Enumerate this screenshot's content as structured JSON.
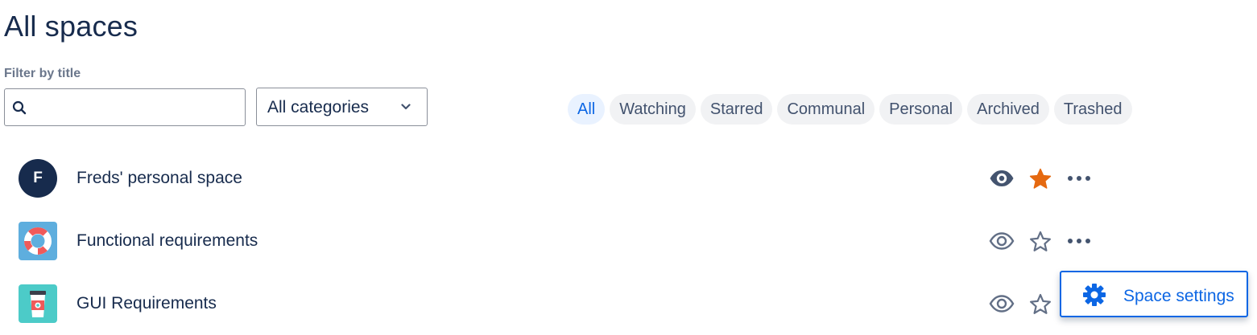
{
  "page": {
    "title": "All spaces"
  },
  "filter": {
    "label": "Filter by title",
    "search_value": "",
    "search_placeholder": ""
  },
  "category_select": {
    "selected": "All categories"
  },
  "tabs": [
    {
      "label": "All",
      "active": true
    },
    {
      "label": "Watching",
      "active": false
    },
    {
      "label": "Starred",
      "active": false
    },
    {
      "label": "Communal",
      "active": false
    },
    {
      "label": "Personal",
      "active": false
    },
    {
      "label": "Archived",
      "active": false
    },
    {
      "label": "Trashed",
      "active": false
    }
  ],
  "spaces": [
    {
      "name": "Freds' personal space",
      "avatar": "F",
      "avatar_icon": "letter-avatar",
      "watching": true,
      "starred": true
    },
    {
      "name": "Functional requirements",
      "avatar_icon": "lifebuoy-icon",
      "watching": false,
      "starred": false
    },
    {
      "name": "GUI Requirements",
      "avatar_icon": "coffee-cup-icon",
      "watching": false,
      "starred": false
    }
  ],
  "context_menu": {
    "item_label": "Space settings",
    "item_icon": "gear-icon"
  },
  "colors": {
    "primary_text": "#172b4d",
    "accent_blue": "#0c66e4",
    "star_active": "#e56910",
    "icon_gray": "#626f86",
    "tab_bg": "#f1f2f4",
    "tab_active_bg": "#e9f2ff"
  }
}
